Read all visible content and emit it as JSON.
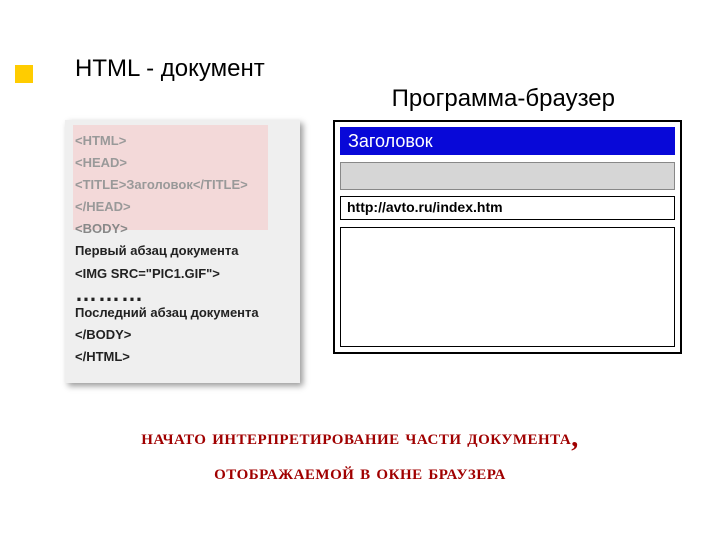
{
  "heading": {
    "left": "HTML - документ",
    "right": "Программа-браузер"
  },
  "code": {
    "line1": "<HTML>",
    "line2": "<HEAD>",
    "line3": "<TITLE>Заголовок</TITLE>",
    "line4": "</HEAD>",
    "line5": "<BODY>",
    "line6": "Первый абзац документа",
    "line7": "<IMG SRC=\"PIC1.GIF\">",
    "dots": "………",
    "line8": "Последний абзац документа",
    "line9": "</BODY>",
    "line10": "</HTML>"
  },
  "browser": {
    "title": "Заголовок",
    "url": "http://avto.ru/index.htm"
  },
  "caption": {
    "line1a": "начато интерпретирование части документа",
    "comma": ",",
    "line2": "отображаемой в окне браузера"
  }
}
